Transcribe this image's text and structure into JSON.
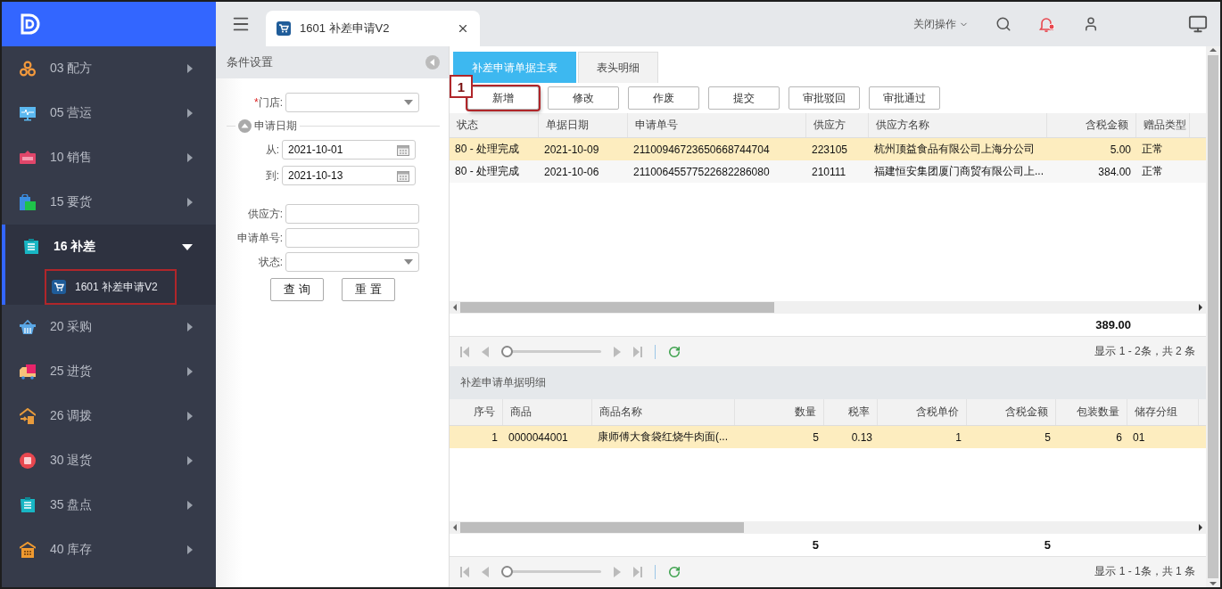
{
  "sidebar": {
    "items": [
      {
        "label": "03 配方",
        "expanded": false
      },
      {
        "label": "05 营运",
        "expanded": false
      },
      {
        "label": "10 销售",
        "expanded": false
      },
      {
        "label": "15 要货",
        "expanded": false
      },
      {
        "label": "16 补差",
        "expanded": true,
        "children": [
          {
            "label": "1601 补差申请V2",
            "selected": true,
            "highlighted": true
          }
        ]
      },
      {
        "label": "20 采购",
        "expanded": false
      },
      {
        "label": "25 进货",
        "expanded": false
      },
      {
        "label": "26 调拨",
        "expanded": false
      },
      {
        "label": "30 退货",
        "expanded": false
      },
      {
        "label": "35 盘点",
        "expanded": false
      },
      {
        "label": "40 库存",
        "expanded": false
      }
    ]
  },
  "topbar": {
    "tabs": [
      {
        "label": "1601 补差申请V2",
        "selected": true
      }
    ],
    "close_menu": "关闭操作"
  },
  "filter_panel": {
    "title": "条件设置",
    "store": {
      "label": "门店:",
      "required_mark": "*"
    },
    "date_group": {
      "legend": "申请日期",
      "expanded": true,
      "from": {
        "label": "从:",
        "value": "2021-10-01"
      },
      "to": {
        "label": "到:",
        "value": "2021-10-13"
      }
    },
    "supplier": {
      "label": "供应方:"
    },
    "request_no": {
      "label": "申请单号:"
    },
    "status": {
      "label": "状态:"
    },
    "buttons": [
      "查 询",
      "重 置"
    ]
  },
  "main": {
    "tabs": [
      {
        "label": "补差申请单据主表",
        "selected": true
      },
      {
        "label": "表头明细",
        "selected": false
      }
    ],
    "toolbar": [
      {
        "label": "新增",
        "callout": "1"
      },
      {
        "label": "修改"
      },
      {
        "label": "作废"
      },
      {
        "label": "提交"
      },
      {
        "label": "审批驳回"
      },
      {
        "label": "审批通过"
      }
    ],
    "master_table": {
      "columns": [
        {
          "label": "状态",
          "kind": "text"
        },
        {
          "label": "单据日期",
          "kind": "text"
        },
        {
          "label": "申请单号",
          "kind": "text"
        },
        {
          "label": "供应方",
          "kind": "text"
        },
        {
          "label": "供应方名称",
          "kind": "text"
        },
        {
          "label": "含税金额",
          "kind": "number",
          "total": "389.00"
        },
        {
          "label": "赠品类型",
          "kind": "text"
        }
      ],
      "rows": [
        {
          "selected": true,
          "cells": [
            "80 - 处理完成",
            "2021-10-09",
            "21100946723650668744704",
            "223105",
            "杭州顶益食品有限公司上海分公司",
            "5.00",
            "正常"
          ]
        },
        {
          "selected": false,
          "cells": [
            "80 - 处理完成",
            "2021-10-06",
            "21100645577522682286080",
            "210111",
            "福建恒安集团厦门商贸有限公司上...",
            "384.00",
            "正常"
          ]
        }
      ],
      "pager": {
        "summary": "显示 1 - 2条，共 2 条",
        "level": 0
      }
    },
    "detail_title": "补差申请单据明细",
    "detail_table": {
      "columns": [
        {
          "label": "序号",
          "kind": "number"
        },
        {
          "label": "商品",
          "kind": "text"
        },
        {
          "label": "商品名称",
          "kind": "text"
        },
        {
          "label": "数量",
          "kind": "number",
          "total": "5"
        },
        {
          "label": "税率",
          "kind": "number"
        },
        {
          "label": "含税单价",
          "kind": "number"
        },
        {
          "label": "含税金额",
          "kind": "number",
          "total": "5"
        },
        {
          "label": "包装数量",
          "kind": "number"
        },
        {
          "label": "储存分组",
          "kind": "text"
        }
      ],
      "rows": [
        {
          "selected": true,
          "cells": [
            "1",
            "0000044001",
            "康师傅大食袋红烧牛肉面(...",
            "5",
            "0.13",
            "1",
            "5",
            "6",
            "01"
          ]
        }
      ],
      "pager": {
        "summary": "显示 1 - 1条，共 1 条",
        "level": 0
      }
    }
  }
}
